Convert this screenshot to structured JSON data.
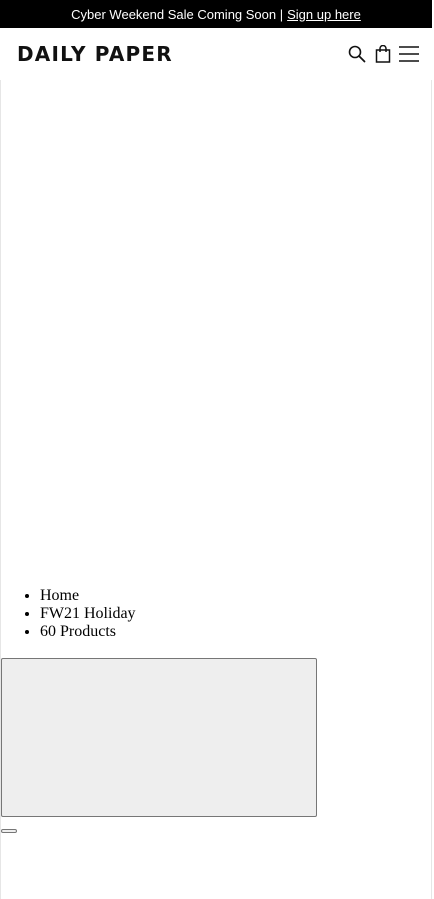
{
  "announcement": {
    "text": "Cyber Weekend Sale Coming Soon |",
    "link_label": "Sign up here"
  },
  "header": {
    "logo": "DAILY PAPER",
    "icons": [
      "search-icon",
      "bag-icon",
      "menu-icon"
    ]
  },
  "breadcrumb": {
    "items": [
      "Home",
      "FW21 Holiday",
      "60 Products"
    ]
  }
}
